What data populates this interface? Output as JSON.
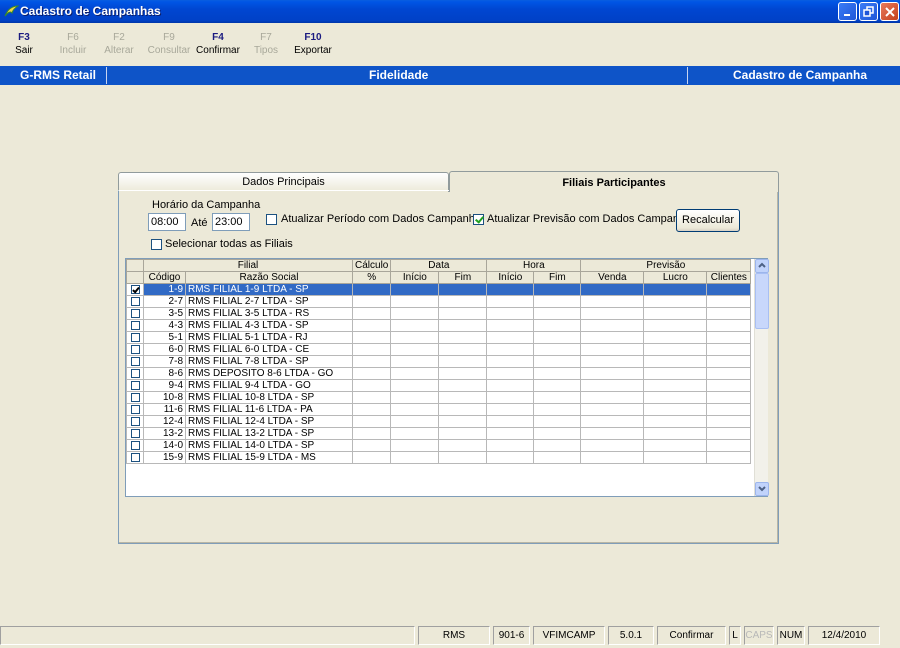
{
  "window": {
    "title": "Cadastro de Campanhas"
  },
  "toolbar": [
    {
      "key": "F3",
      "label": "Sair",
      "enabled": true
    },
    {
      "key": "F6",
      "label": "Incluir",
      "enabled": false
    },
    {
      "key": "F2",
      "label": "Alterar",
      "enabled": false
    },
    {
      "key": "F9",
      "label": "Consultar",
      "enabled": false
    },
    {
      "key": "F4",
      "label": "Confirmar",
      "enabled": true
    },
    {
      "key": "F7",
      "label": "Tipos",
      "enabled": false
    },
    {
      "key": "F10",
      "label": "Exportar",
      "enabled": true
    }
  ],
  "header": {
    "left": "G-RMS Retail",
    "center": "Fidelidade",
    "right": "Cadastro de Campanha"
  },
  "tabs": [
    {
      "label": "Dados Principais",
      "active": false
    },
    {
      "label": "Filiais Participantes",
      "active": true
    }
  ],
  "form": {
    "horario_label": "Horário da Campanha",
    "hora_inicio": "08:00",
    "ate_label": "Até",
    "hora_fim": "23:00",
    "atualizar_periodo_label": "Atualizar Período com Dados Campanha",
    "atualizar_periodo_checked": false,
    "atualizar_previsao_label": "Atualizar Previsão com Dados Campanha",
    "atualizar_previsao_checked": true,
    "recalcular_label": "Recalcular",
    "selecionar_todas_label": "Selecionar todas as Filiais",
    "selecionar_todas_checked": false
  },
  "grid": {
    "groups": [
      "Filial",
      "Cálculo",
      "Data",
      "Hora",
      "Previsão"
    ],
    "columns": [
      "Código",
      "Razão Social",
      "%",
      "Início",
      "Fim",
      "Início",
      "Fim",
      "Venda",
      "Lucro",
      "Clientes"
    ],
    "rows": [
      {
        "checked": true,
        "selected": true,
        "codigo": "1-9",
        "razao": "RMS FILIAL 1-9 LTDA - SP"
      },
      {
        "checked": false,
        "codigo": "2-7",
        "razao": "RMS FILIAL 2-7 LTDA - SP"
      },
      {
        "checked": false,
        "codigo": "3-5",
        "razao": "RMS FILIAL 3-5 LTDA - RS"
      },
      {
        "checked": false,
        "codigo": "4-3",
        "razao": "RMS FILIAL 4-3 LTDA - SP"
      },
      {
        "checked": false,
        "codigo": "5-1",
        "razao": "RMS FILIAL 5-1 LTDA - RJ"
      },
      {
        "checked": false,
        "codigo": "6-0",
        "razao": "RMS FILIAL 6-0 LTDA - CE"
      },
      {
        "checked": false,
        "codigo": "7-8",
        "razao": "RMS FILIAL 7-8 LTDA - SP"
      },
      {
        "checked": false,
        "codigo": "8-6",
        "razao": "RMS DEPOSITO 8-6 LTDA - GO"
      },
      {
        "checked": false,
        "codigo": "9-4",
        "razao": "RMS FILIAL 9-4 LTDA - GO"
      },
      {
        "checked": false,
        "codigo": "10-8",
        "razao": "RMS FILIAL 10-8 LTDA - SP"
      },
      {
        "checked": false,
        "codigo": "11-6",
        "razao": "RMS FILIAL 11-6 LTDA - PA"
      },
      {
        "checked": false,
        "codigo": "12-4",
        "razao": "RMS FILIAL 12-4 LTDA - SP"
      },
      {
        "checked": false,
        "codigo": "13-2",
        "razao": "RMS FILIAL 13-2 LTDA - SP"
      },
      {
        "checked": false,
        "codigo": "14-0",
        "razao": "RMS FILIAL 14-0 LTDA - SP"
      },
      {
        "checked": false,
        "codigo": "15-9",
        "razao": "RMS FILIAL 15-9 LTDA - MS"
      }
    ]
  },
  "statusbar": [
    "RMS",
    "901-6",
    "VFIMCAMP",
    "5.0.1",
    "Confirmar",
    "L",
    "CAPS",
    "NUM",
    "12/4/2010"
  ],
  "colors": {
    "title_bar": "#0046d1",
    "header_bar": "#0e54c8",
    "selection": "#316ac5"
  }
}
